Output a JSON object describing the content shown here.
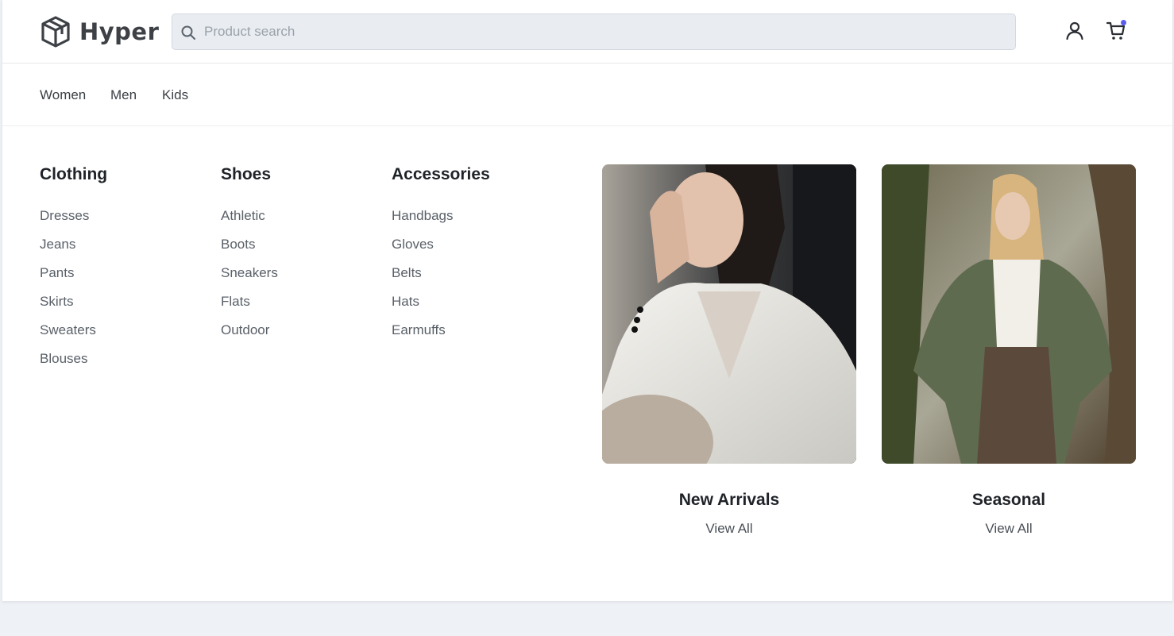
{
  "brand": {
    "name": "Hyper",
    "logo_icon": "cube-logo-icon"
  },
  "search": {
    "placeholder": "Product search",
    "value": "",
    "icon": "search-icon"
  },
  "header_actions": {
    "user_icon": "user-icon",
    "cart_icon": "cart-icon",
    "cart_badge_color": "#5b5bf0"
  },
  "nav": {
    "items": [
      "Women",
      "Men",
      "Kids"
    ]
  },
  "menu": {
    "columns": [
      {
        "title": "Clothing",
        "items": [
          "Dresses",
          "Jeans",
          "Pants",
          "Skirts",
          "Sweaters",
          "Blouses"
        ]
      },
      {
        "title": "Shoes",
        "items": [
          "Athletic",
          "Boots",
          "Sneakers",
          "Flats",
          "Outdoor"
        ]
      },
      {
        "title": "Accessories",
        "items": [
          "Handbags",
          "Gloves",
          "Belts",
          "Hats",
          "Earmuffs"
        ]
      }
    ],
    "features": [
      {
        "title": "New Arrivals",
        "link": "View All"
      },
      {
        "title": "Seasonal",
        "link": "View All"
      }
    ]
  },
  "colors": {
    "background": "#eef1f5",
    "panel": "#ffffff",
    "accent": "#5b5bf0",
    "search_bg": "#e9edf2"
  }
}
